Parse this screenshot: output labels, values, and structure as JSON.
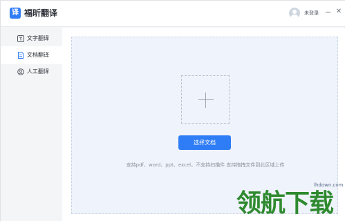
{
  "app": {
    "logo_char": "译",
    "name": "福昕翻译",
    "login_label": "未登录",
    "close_glyph": "✕"
  },
  "sidebar": {
    "items": [
      {
        "label": "文字翻译",
        "icon": "text-translate-icon",
        "active": false
      },
      {
        "label": "文档翻译",
        "icon": "document-translate-icon",
        "active": true
      },
      {
        "label": "人工翻译",
        "icon": "human-translate-icon",
        "active": false
      }
    ]
  },
  "main": {
    "upload_button_label": "选择文档",
    "hint": "支持pdf、word、ppt、excel，不支持扫描件 支持拖拽文件到此区域上传"
  },
  "watermark": {
    "url": "lhdown.com",
    "text": "领航下载"
  },
  "colors": {
    "accent": "#2f7df6",
    "dropzone_bg": "#eff3fb"
  }
}
